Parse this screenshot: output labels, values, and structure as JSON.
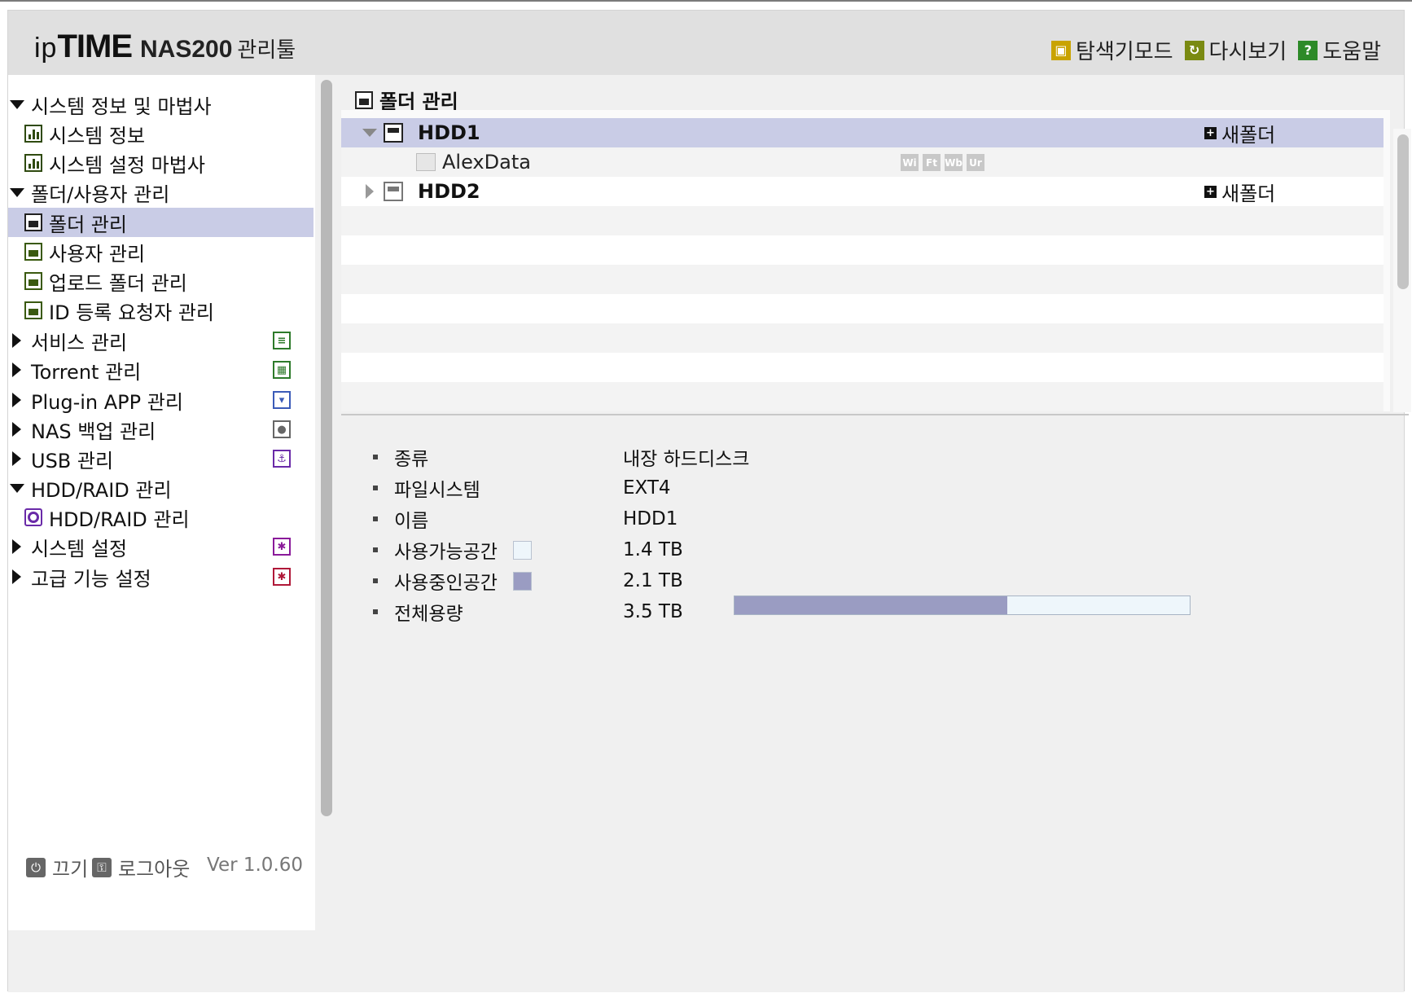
{
  "header": {
    "logo_ip": "ip",
    "logo_time": "TIME",
    "logo_model": "NAS200",
    "logo_tool": "관리툴",
    "links": [
      {
        "label": "탐색기모드",
        "icon": "explorer-mode-icon"
      },
      {
        "label": "다시보기",
        "icon": "refresh-icon"
      },
      {
        "label": "도움말",
        "icon": "help-icon"
      }
    ]
  },
  "sidebar": {
    "groups": [
      {
        "label": "시스템 정보 및 마법사",
        "expanded": true
      },
      {
        "label": "폴더/사용자 관리",
        "expanded": true
      },
      {
        "label": "HDD/RAID 관리",
        "expanded": true
      }
    ],
    "items": [
      {
        "label": "시스템 정보"
      },
      {
        "label": "시스템 설정 마법사"
      },
      {
        "label": "폴더 관리",
        "active": true
      },
      {
        "label": "사용자 관리"
      },
      {
        "label": "업로드 폴더 관리"
      },
      {
        "label": "ID 등록 요청자 관리"
      },
      {
        "label": "HDD/RAID 관리"
      }
    ],
    "collapsed": [
      {
        "label": "서비스 관리",
        "icon": "service-icon",
        "color": "#2d7a2a"
      },
      {
        "label": "Torrent 관리",
        "icon": "torrent-icon",
        "color": "#2d7a2a"
      },
      {
        "label": "Plug-in APP 관리",
        "icon": "plugin-icon",
        "color": "#3b5bb8"
      },
      {
        "label": "NAS 백업 관리",
        "icon": "backup-icon",
        "color": "#666666"
      },
      {
        "label": "USB 관리",
        "icon": "usb-icon",
        "color": "#6a2aa8"
      },
      {
        "label": "시스템 설정",
        "icon": "system-settings-icon",
        "color": "#8a1a9a"
      },
      {
        "label": "고급 기능 설정",
        "icon": "advanced-settings-icon",
        "color": "#b01838"
      }
    ]
  },
  "main": {
    "title": "폴더 관리",
    "tree": [
      {
        "name": "HDD1",
        "expanded": true,
        "action": "새폴더"
      },
      {
        "name": "AlexData",
        "permissions": [
          "Wi",
          "Ft",
          "Wb",
          "Ur"
        ]
      },
      {
        "name": "HDD2",
        "expanded": false,
        "action": "새폴더"
      }
    ],
    "info": [
      {
        "label": "종류",
        "value": "내장 하드디스크"
      },
      {
        "label": "파일시스템",
        "value": "EXT4"
      },
      {
        "label": "이름",
        "value": "HDD1"
      },
      {
        "label": "사용가능공간",
        "value": "1.4 TB",
        "swatch": "#eef6fb"
      },
      {
        "label": "사용중인공간",
        "value": "2.1 TB",
        "swatch": "#9a9cc2"
      },
      {
        "label": "전체용량",
        "value": "3.5 TB"
      }
    ],
    "usage_fraction": 0.6,
    "usage_color": "#9a9cc2"
  },
  "footer": {
    "power_label": "끄기",
    "logout_label": "로그아웃",
    "version": "Ver 1.0.60"
  }
}
